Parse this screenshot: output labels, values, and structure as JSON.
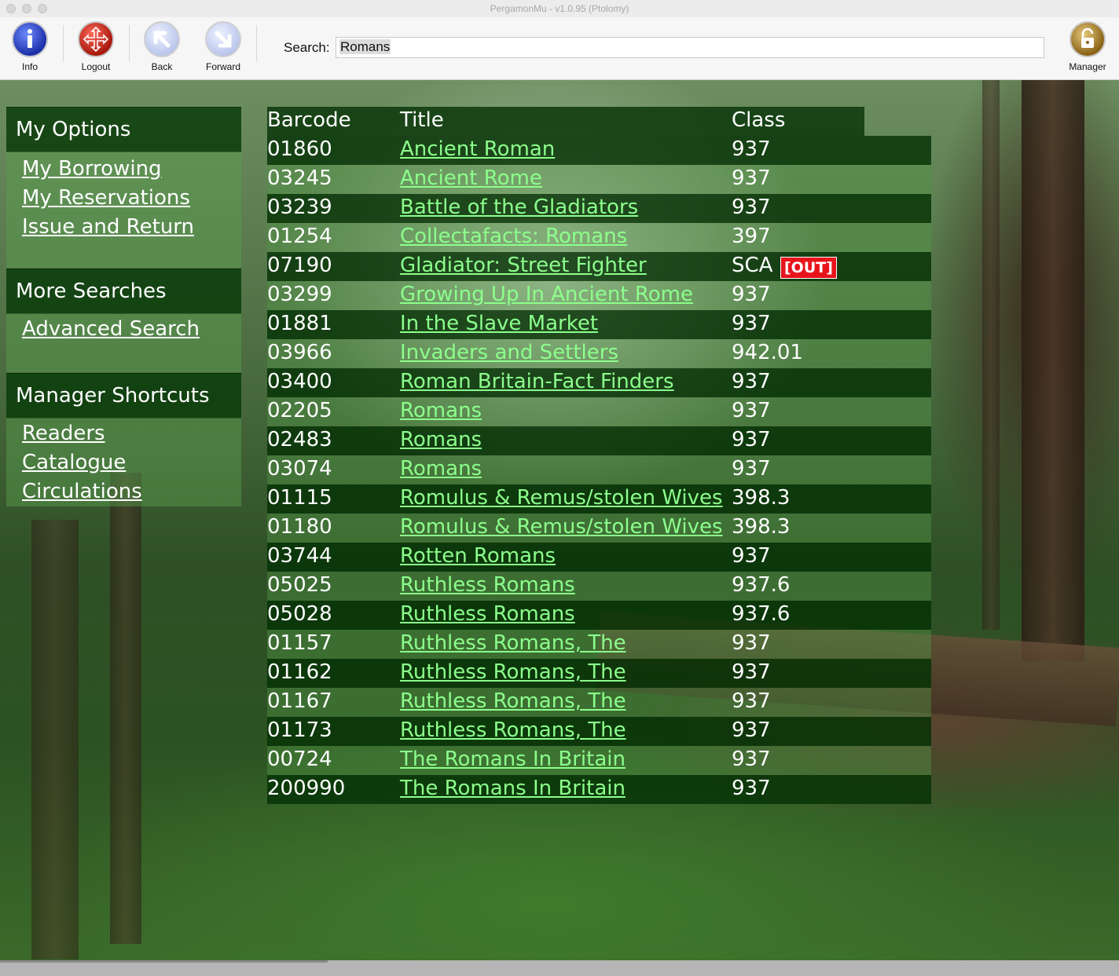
{
  "window": {
    "title": "PergamonMu - v1.0.95 (Ptolomy)"
  },
  "toolbar": {
    "info_label": "Info",
    "logout_label": "Logout",
    "back_label": "Back",
    "forward_label": "Forward",
    "manager_label": "Manager",
    "search_label": "Search:",
    "search_value": "Romans"
  },
  "sidebar": {
    "my_options": {
      "title": "My Options",
      "links": [
        "My Borrowing",
        "My Reservations",
        "Issue and Return"
      ]
    },
    "more_searches": {
      "title": "More Searches",
      "links": [
        "Advanced Search"
      ]
    },
    "manager_shortcuts": {
      "title": "Manager Shortcuts",
      "links": [
        "Readers",
        "Catalogue",
        "Circulations"
      ]
    }
  },
  "results": {
    "headers": {
      "barcode": "Barcode",
      "title": "Title",
      "class": "Class"
    },
    "out_label": "[OUT]",
    "rows": [
      {
        "barcode": "01860",
        "title": "Ancient Roman",
        "class": "937"
      },
      {
        "barcode": "03245",
        "title": "Ancient Rome",
        "class": "937"
      },
      {
        "barcode": "03239",
        "title": "Battle of the Gladiators",
        "class": "937"
      },
      {
        "barcode": "01254",
        "title": "Collectafacts: Romans",
        "class": "397"
      },
      {
        "barcode": "07190",
        "title": "Gladiator: Street Fighter",
        "class": "SCA"
      },
      {
        "barcode": "03299",
        "title": "Growing Up In Ancient Rome",
        "class": "937"
      },
      {
        "barcode": "01881",
        "title": "In the Slave Market",
        "class": "937"
      },
      {
        "barcode": "03966",
        "title": "Invaders and Settlers",
        "class": "942.01"
      },
      {
        "barcode": "03400",
        "title": "Roman Britain-Fact Finders",
        "class": "937"
      },
      {
        "barcode": "02205",
        "title": "Romans",
        "class": "937"
      },
      {
        "barcode": "02483",
        "title": "Romans",
        "class": "937"
      },
      {
        "barcode": "03074",
        "title": "Romans",
        "class": "937"
      },
      {
        "barcode": "01115",
        "title": "Romulus & Remus/stolen Wives",
        "class": "398.3"
      },
      {
        "barcode": "01180",
        "title": "Romulus & Remus/stolen Wives",
        "class": "398.3"
      },
      {
        "barcode": "03744",
        "title": "Rotten Romans",
        "class": "937"
      },
      {
        "barcode": "05025",
        "title": "Ruthless Romans",
        "class": "937.6"
      },
      {
        "barcode": "05028",
        "title": "Ruthless Romans",
        "class": "937.6"
      },
      {
        "barcode": "01157",
        "title": "Ruthless Romans, The",
        "class": "937"
      },
      {
        "barcode": "01162",
        "title": "Ruthless Romans, The",
        "class": "937"
      },
      {
        "barcode": "01167",
        "title": "Ruthless Romans, The",
        "class": "937"
      },
      {
        "barcode": "01173",
        "title": "Ruthless Romans, The",
        "class": "937"
      },
      {
        "barcode": "00724",
        "title": "The Romans In Britain",
        "class": "937"
      },
      {
        "barcode": "200990",
        "title": "The Romans In Britain",
        "class": "937"
      }
    ]
  },
  "colors": {
    "link": "#8cff8c",
    "out_badge": "#e8141c"
  },
  "icons": {
    "info": "info-icon",
    "logout": "logout-icon",
    "back": "back-arrow-icon",
    "forward": "forward-arrow-icon",
    "manager": "padlock-icon"
  }
}
